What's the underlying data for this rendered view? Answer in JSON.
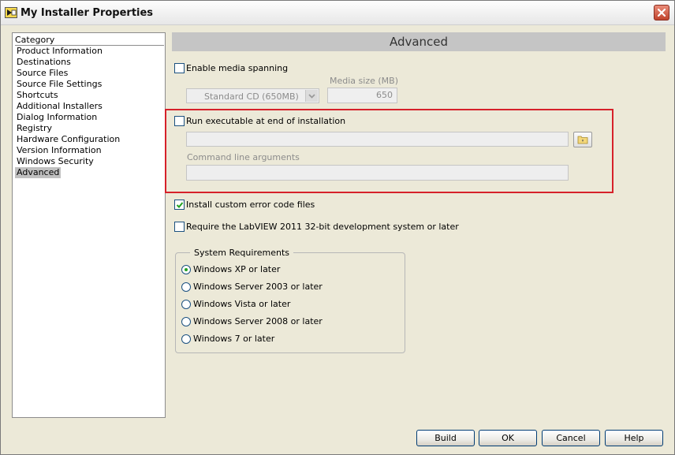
{
  "window": {
    "title": "My Installer Properties"
  },
  "category": {
    "header": "Category",
    "items": [
      "Product Information",
      "Destinations",
      "Source Files",
      "Source File Settings",
      "Shortcuts",
      "Additional Installers",
      "Dialog Information",
      "Registry",
      "Hardware Configuration",
      "Version Information",
      "Windows Security",
      "Advanced"
    ],
    "selected": "Advanced"
  },
  "section": {
    "title": "Advanced"
  },
  "media_spanning": {
    "label": "Enable media spanning",
    "checked": false,
    "media_type_value": "Standard CD (650MB)",
    "media_size_label": "Media size (MB)",
    "media_size_value": "650"
  },
  "run_executable": {
    "label": "Run executable at end of installation",
    "checked": false,
    "path_value": "",
    "cmd_label": "Command line arguments",
    "cmd_value": ""
  },
  "custom_error": {
    "label": "Install custom error code files",
    "checked": true
  },
  "require_labview": {
    "label": "Require the LabVIEW 2011 32-bit development system or later",
    "checked": false
  },
  "system_requirements": {
    "title": "System Requirements",
    "options": [
      "Windows XP or later",
      "Windows Server 2003 or later",
      "Windows Vista or later",
      "Windows Server 2008 or later",
      "Windows 7 or later"
    ],
    "selected": "Windows XP or later"
  },
  "buttons": {
    "build": "Build",
    "ok": "OK",
    "cancel": "Cancel",
    "help": "Help"
  },
  "colors": {
    "highlight_box": "#d6212a",
    "check_green": "#21a121",
    "header_bg": "#c5c5c5"
  }
}
